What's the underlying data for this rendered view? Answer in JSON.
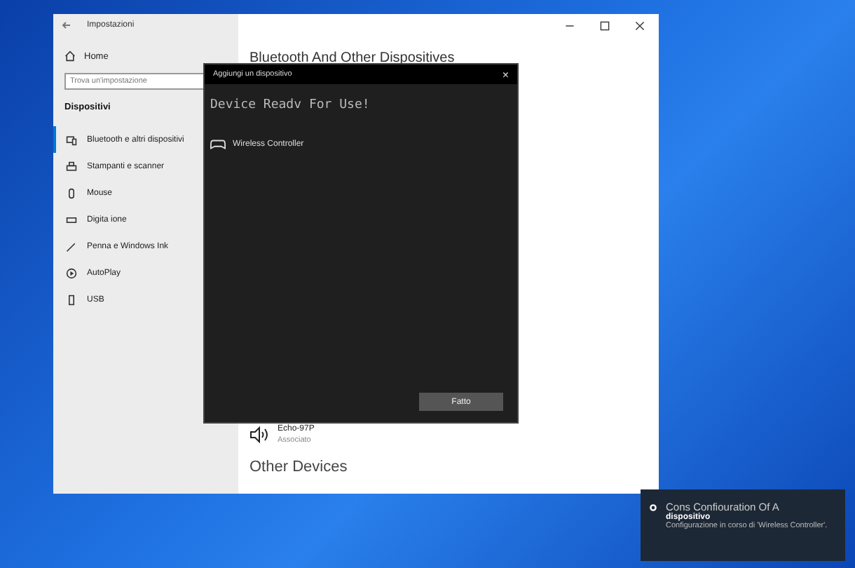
{
  "window": {
    "title": "Impostazioni"
  },
  "sidebar": {
    "home": "Home",
    "search": {
      "placeholder": "Trova un'impostazione"
    },
    "section": "Dispositivi",
    "items": [
      {
        "label": "Bluetooth e altri dispositivi",
        "selected": true
      },
      {
        "label": "Stampanti e scanner",
        "selected": false
      },
      {
        "label": "Mouse",
        "selected": false
      },
      {
        "label": "Digita ione",
        "selected": false
      },
      {
        "label": "Penna e Windows Ink",
        "selected": false
      },
      {
        "label": "AutoPlay",
        "selected": false
      },
      {
        "label": "USB",
        "selected": false
      }
    ]
  },
  "content": {
    "heading": "Bluetooth And Other Dispositives",
    "device": {
      "name": "Echo-97P",
      "status": "Associato"
    },
    "section2": "Other Devices"
  },
  "dialog": {
    "title": "Aggiungi un dispositivo",
    "close": "×",
    "heading": "Device Readv For Use!",
    "device": "Wireless Controller",
    "button": "Fatto"
  },
  "toast": {
    "title": "Cons Confiouration Of A",
    "subtitle": "dispositivo",
    "body": "Configurazione in corso di 'Wireless Controller'."
  }
}
